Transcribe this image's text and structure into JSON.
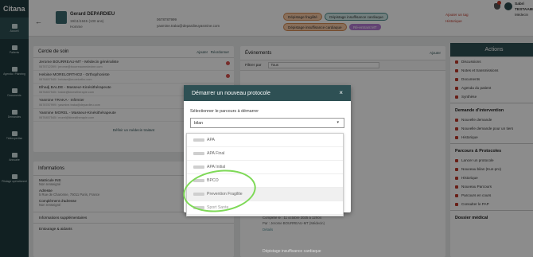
{
  "sidebar": {
    "logo": "Citana",
    "items": [
      {
        "label": "Accueil"
      },
      {
        "label": "Patients"
      },
      {
        "label": "Agenda / Planning"
      },
      {
        "label": "Documents"
      },
      {
        "label": "Demandes"
      },
      {
        "label": "Téléexpertise"
      },
      {
        "label": "Annuaire"
      },
      {
        "label": "Pilotage opérationnel"
      }
    ]
  },
  "topbar": {
    "patient_name": "Gerard DEPARDIEU",
    "dob": "19/11/1945 (100 ans)",
    "sex": "Homme",
    "phone": "0678787999",
    "email": "yasmine.traka@depardieuyasmine.com",
    "tags": [
      {
        "label": "Dépistage fragilité",
        "color": "orange"
      },
      {
        "label": "Dépistage insuffisance cardiaque",
        "color": "teal"
      },
      {
        "label": "Dépistage insuffisance cardiaque",
        "color": "orange"
      },
      {
        "label": "Ré-entrant MT",
        "color": "purple"
      }
    ],
    "links": [
      "Ajouter un tag",
      "Historique"
    ],
    "user_name": "Sabri TESTAABRI",
    "user_role": "Médecin",
    "notifications": "1"
  },
  "cercle": {
    "title": "Cercle de soin",
    "add": "Ajouter",
    "reorder": "Réordonner",
    "members": [
      {
        "name": "Jerome BOURREAU-MT - Médecin généraliste",
        "meta": "0678712399 / jerome@bourreaumedecine.com"
      },
      {
        "name": "Heloise MORELORTHO2 - Orthophoniste",
        "meta": "0678457545 / heloise@morelortho.com"
      },
      {
        "name": "Elhadj BALDE - Masseur-Kinésithérapeute",
        "meta": "0678457545 / balde@kinesitherapie.com"
      },
      {
        "name": "Yasmine TRAKA - Infirmier",
        "meta": "0678787999 / yasmine.traka@depardieu.com"
      },
      {
        "name": "Yasmine MOREL - Masseur-Kinésithérapeute",
        "meta": "0678457545 / morel@kinesitherapie.com"
      }
    ],
    "traitant": "Définir un médecin traitant"
  },
  "infos": {
    "title": "Informations",
    "fields": [
      {
        "label": "Matricule INS",
        "value": "Non renseigné"
      },
      {
        "label": "Adresse",
        "value": "5 Rue de Charonne, 75011 Paris, France"
      },
      {
        "label": "Complément d'adresse",
        "value": "Non renseigné"
      }
    ],
    "sections": [
      "Informations supplémentaires",
      "Entourage & aidants"
    ]
  },
  "events": {
    "title": "Événements",
    "add": "Ajouter",
    "filter_label": "Filtrer par",
    "filter_value": "Tous",
    "created_line": "Complété le : 11 octobre 2025 à 12h04",
    "by_line": "Par : Jerome BOURREAU-MT (Médecin)",
    "details": "Détails",
    "last_event": "Dépistage insuffisance cardiaque"
  },
  "actions": {
    "title": "Actions",
    "group1": [
      "Discussions",
      "Notes et transmissions",
      "Documents",
      "Agenda du patient",
      "Synthèse"
    ],
    "section2": "Demande d'intervention",
    "group2": [
      "Nouvelle demande",
      "Nouvelle demande pour un tiers",
      "Historique"
    ],
    "section3": "Parcours & Protocoles",
    "group3": [
      "Lancer un protocole",
      "Nouveau bilan (Kun-pro)",
      "Historique",
      "Nouveau Parcours",
      "Parcours en cours",
      "Consulter le PAP"
    ],
    "section4": "Dossier médical"
  },
  "modal": {
    "title": "Démarrer un nouveau protocole",
    "close": "×",
    "label": "Sélectionner le parcours à démarrer",
    "search_value": "bilan",
    "options": [
      "APA",
      "APA Final",
      "APA Initial",
      "BPCO",
      "Prevention Fragilite",
      "Sport Sante"
    ],
    "highlighted": "Prevention Fragilite"
  },
  "colors": {
    "sidebar": "#1f3b3e",
    "accent": "#2e5054",
    "danger": "#c0392b",
    "annotation": "#7ed957"
  }
}
